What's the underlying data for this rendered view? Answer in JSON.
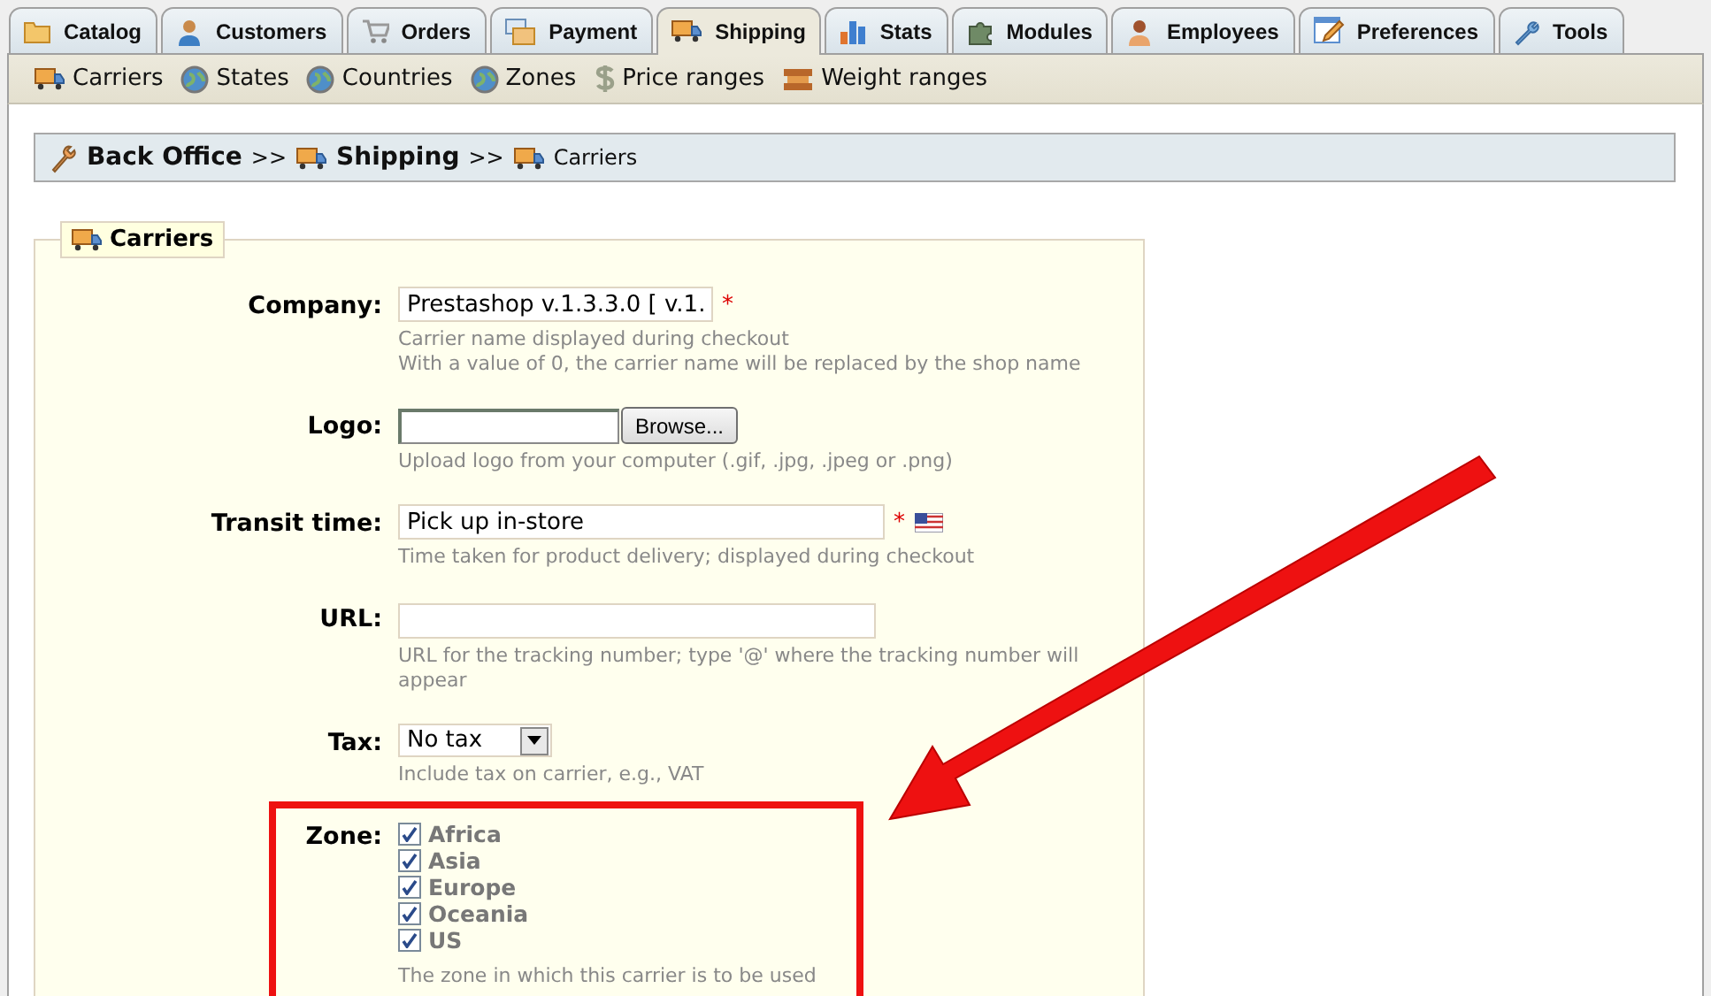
{
  "tabs": [
    {
      "label": "Catalog",
      "selected": false
    },
    {
      "label": "Customers",
      "selected": false
    },
    {
      "label": "Orders",
      "selected": false
    },
    {
      "label": "Payment",
      "selected": false
    },
    {
      "label": "Shipping",
      "selected": true
    },
    {
      "label": "Stats",
      "selected": false
    },
    {
      "label": "Modules",
      "selected": false
    },
    {
      "label": "Employees",
      "selected": false
    },
    {
      "label": "Preferences",
      "selected": false
    },
    {
      "label": "Tools",
      "selected": false
    }
  ],
  "subnav": [
    "Carriers",
    "States",
    "Countries",
    "Zones",
    "Price ranges",
    "Weight ranges"
  ],
  "breadcrumb": [
    {
      "label": "Back Office",
      "bold": true
    },
    {
      "label": ">>",
      "bold": false
    },
    {
      "label": "Shipping",
      "bold": true
    },
    {
      "label": ">>",
      "bold": false
    },
    {
      "label": "Carriers",
      "bold": false
    }
  ],
  "fieldset": {
    "legend": "Carriers",
    "fields": [
      {
        "kind": "text",
        "label": "Company:",
        "value": "Prestashop v.1.3.3.0 [ v.1.",
        "required_mark": "*",
        "flag": false,
        "hint": [
          "Carrier name displayed during checkout",
          "With a value of 0, the carrier name will be replaced by the shop name"
        ]
      },
      {
        "kind": "file",
        "label": "Logo:",
        "button": "Browse...",
        "hint": [
          "Upload logo from your computer (.gif, .jpg, .jpeg or .png)"
        ]
      },
      {
        "kind": "text",
        "label": "Transit time:",
        "value": "Pick up in-store",
        "required_mark": "*",
        "flag": true,
        "hint": [
          "Time taken for product delivery; displayed during checkout"
        ]
      },
      {
        "kind": "wide",
        "label": "URL:",
        "flag": false,
        "hint": [
          "URL for the tracking number; type '@' where the tracking number will appear"
        ]
      },
      {
        "kind": "select",
        "label": "Tax:",
        "value": "No tax",
        "hint": [
          "Include tax on carrier, e.g., VAT"
        ]
      },
      {
        "kind": "checkboxes",
        "label": "Zone:",
        "options": [
          {
            "label": "Africa",
            "checked": true
          },
          {
            "label": "Asia",
            "checked": true
          },
          {
            "label": "Europe",
            "checked": true
          },
          {
            "label": "Oceania",
            "checked": true
          },
          {
            "label": "US",
            "checked": true
          }
        ],
        "hint": [
          "The zone in which this carrier is to be used"
        ]
      }
    ]
  }
}
